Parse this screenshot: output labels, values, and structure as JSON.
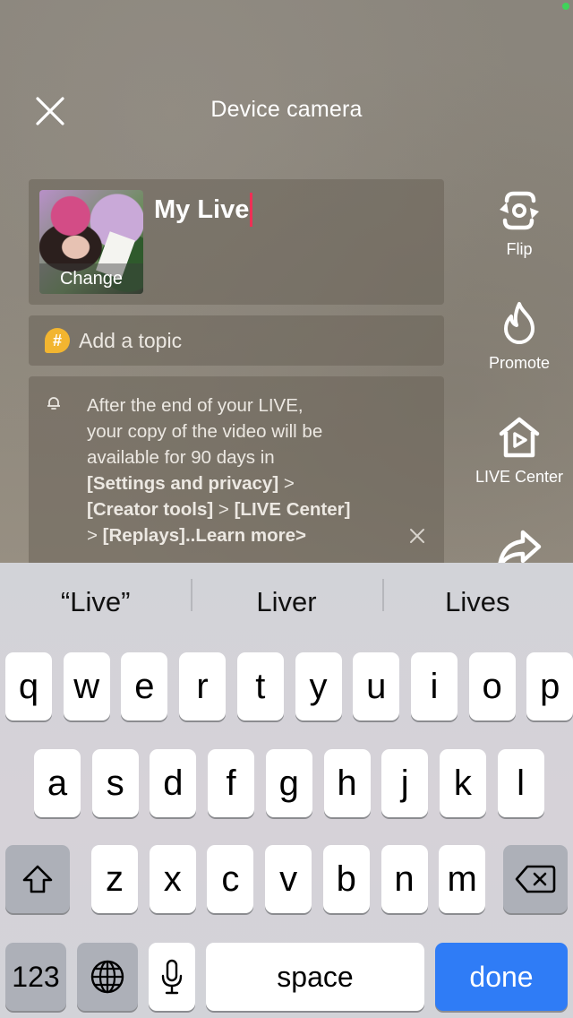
{
  "header": {
    "title": "Device camera",
    "close_icon": "close-icon"
  },
  "live_setup": {
    "cover_label": "Change",
    "title_value": "My Live",
    "topic_placeholder": "Add a topic",
    "topic_icon": "hashtag-icon",
    "notice": {
      "icon": "bell-icon",
      "line1": "After the end of your LIVE,",
      "line2": "your copy of the video will be",
      "line3": "available for 90 days in",
      "path1": "[Settings and privacy]",
      "sep1": " >",
      "path2": "[Creator tools]",
      "sep2": " > ",
      "path3": "[LIVE Center]",
      "sep3": "> ",
      "path4": "[Replays]",
      "learn_more": "..Learn more>"
    }
  },
  "side_actions": [
    {
      "label": "Flip",
      "icon": "flip-camera-icon"
    },
    {
      "label": "Promote",
      "icon": "flame-icon"
    },
    {
      "label": "LIVE Center",
      "icon": "live-center-home-icon"
    },
    {
      "label": "",
      "icon": "share-arrow-icon"
    }
  ],
  "keyboard": {
    "suggestions": [
      "“Live”",
      "Liver",
      "Lives"
    ],
    "row1": [
      "q",
      "w",
      "e",
      "r",
      "t",
      "y",
      "u",
      "i",
      "o",
      "p"
    ],
    "row2": [
      "a",
      "s",
      "d",
      "f",
      "g",
      "h",
      "j",
      "k",
      "l"
    ],
    "row3": [
      "z",
      "x",
      "c",
      "v",
      "b",
      "n",
      "m"
    ],
    "numbers_label": "123",
    "space_label": "space",
    "done_label": "done"
  },
  "colors": {
    "accent_caret": "#ee2f55",
    "done_key": "#2f7cf6",
    "topic_icon": "#f2b530",
    "status_dot": "#3fd35a"
  }
}
